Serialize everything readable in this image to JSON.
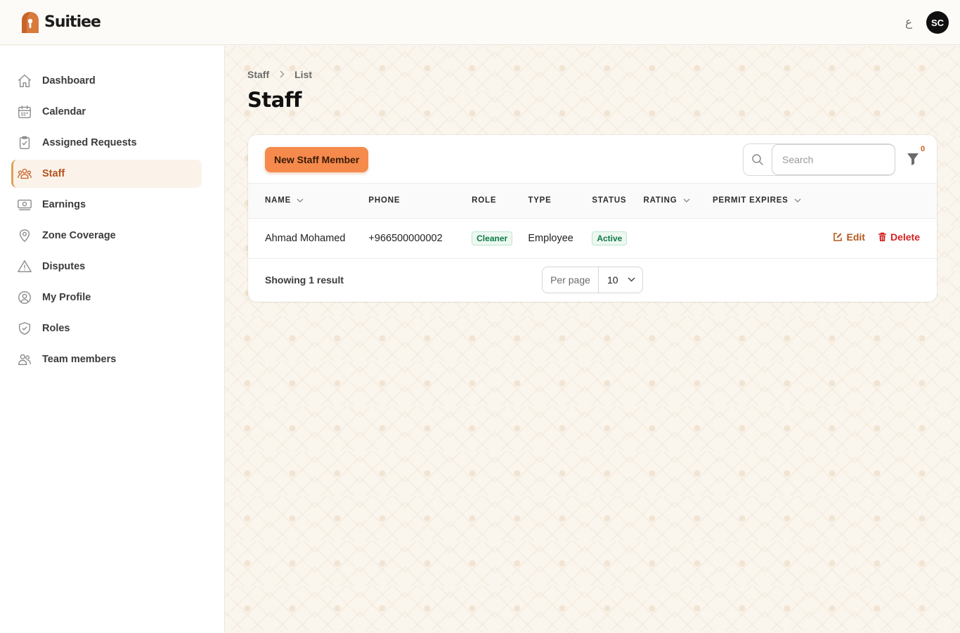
{
  "app": {
    "name": "Suitiee",
    "language_toggle": "ع",
    "user_initials": "SC",
    "accent": "#f58a4c"
  },
  "sidebar": {
    "items": [
      {
        "label": "Dashboard",
        "icon": "home-icon",
        "active": false
      },
      {
        "label": "Calendar",
        "icon": "calendar-icon",
        "active": false
      },
      {
        "label": "Assigned Requests",
        "icon": "clipboard-check-icon",
        "active": false
      },
      {
        "label": "Staff",
        "icon": "user-group-icon",
        "active": true
      },
      {
        "label": "Earnings",
        "icon": "cash-icon",
        "active": false
      },
      {
        "label": "Zone Coverage",
        "icon": "map-pin-icon",
        "active": false
      },
      {
        "label": "Disputes",
        "icon": "warning-triangle-icon",
        "active": false
      },
      {
        "label": "My Profile",
        "icon": "user-circle-icon",
        "active": false
      },
      {
        "label": "Roles",
        "icon": "shield-check-icon",
        "active": false
      },
      {
        "label": "Team members",
        "icon": "users-icon",
        "active": false
      }
    ]
  },
  "breadcrumb": [
    "Staff",
    "List"
  ],
  "page_title": "Staff",
  "toolbar": {
    "new_button": "New Staff Member",
    "search_placeholder": "Search",
    "filter_count": "0"
  },
  "table": {
    "columns": [
      "NAME",
      "PHONE",
      "ROLE",
      "TYPE",
      "STATUS",
      "RATING",
      "PERMIT EXPIRES"
    ],
    "rows": [
      {
        "name": "Ahmad Mohamed",
        "phone": "+966500000002",
        "role": "Cleaner",
        "type": "Employee",
        "status": "Active",
        "rating": "",
        "permit_expires": "",
        "edit_label": "Edit",
        "delete_label": "Delete"
      }
    ]
  },
  "footer": {
    "showing": "Showing 1 result",
    "per_page_label": "Per page",
    "per_page_value": "10"
  }
}
